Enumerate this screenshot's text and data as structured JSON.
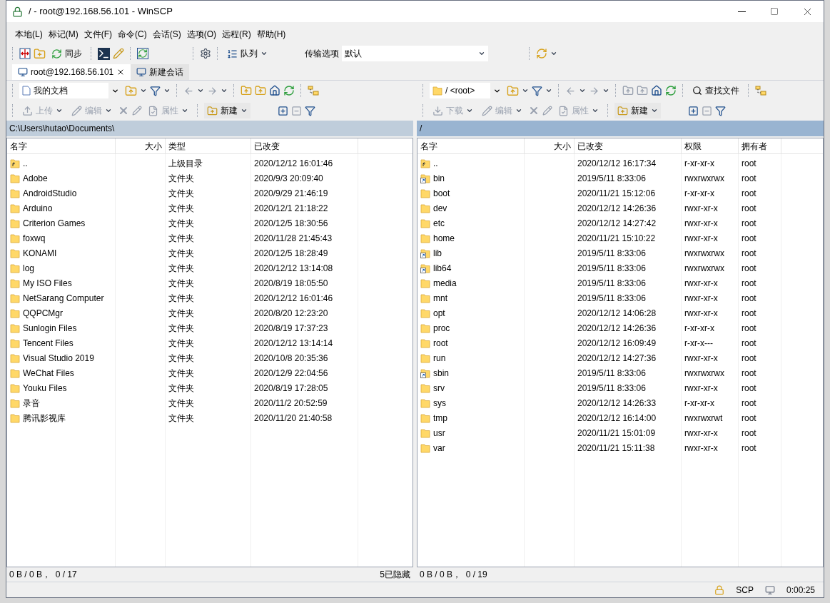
{
  "window": {
    "title": "/ - root@192.168.56.101 - WinSCP"
  },
  "menu": [
    "本地(L)",
    "标记(M)",
    "文件(F)",
    "命令(C)",
    "会话(S)",
    "选项(O)",
    "远程(R)",
    "帮助(H)"
  ],
  "toolbar": {
    "sync_label": "同步",
    "queue_label": "队列",
    "transfer_label": "传输选项",
    "transfer_value": "默认"
  },
  "tabs": [
    {
      "label": "root@192.168.56.101",
      "selected": true,
      "kind": "session"
    },
    {
      "label": "新建会话",
      "selected": false,
      "kind": "new"
    }
  ],
  "local": {
    "active": false,
    "location": "我的文档",
    "actions": [
      {
        "label": "上传",
        "disabled": true,
        "kind": "upload"
      },
      {
        "label": "编辑",
        "disabled": true,
        "kind": "edit"
      },
      {
        "label": "属性",
        "disabled": true,
        "kind": "properties"
      },
      {
        "label": "新建",
        "disabled": false,
        "kind": "new"
      }
    ],
    "path": "C:\\Users\\hutao\\Documents\\",
    "columns": [
      "名字",
      "大小",
      "类型",
      "已改变"
    ],
    "rows": [
      {
        "name": "..",
        "size": "",
        "type": "上级目录",
        "changed": "2020/12/12  16:01:46",
        "kind": "parent"
      },
      {
        "name": "Adobe",
        "type": "文件夹",
        "changed": "2020/9/3  20:09:40",
        "kind": "folder"
      },
      {
        "name": "AndroidStudio",
        "type": "文件夹",
        "changed": "2020/9/29  21:46:19",
        "kind": "folder"
      },
      {
        "name": "Arduino",
        "type": "文件夹",
        "changed": "2020/12/1  21:18:22",
        "kind": "folder"
      },
      {
        "name": "Criterion Games",
        "type": "文件夹",
        "changed": "2020/12/5  18:30:56",
        "kind": "folder"
      },
      {
        "name": "foxwq",
        "type": "文件夹",
        "changed": "2020/11/28  21:45:43",
        "kind": "folder"
      },
      {
        "name": "KONAMI",
        "type": "文件夹",
        "changed": "2020/12/5  18:28:49",
        "kind": "folder"
      },
      {
        "name": "log",
        "type": "文件夹",
        "changed": "2020/12/12  13:14:08",
        "kind": "folder"
      },
      {
        "name": "My ISO Files",
        "type": "文件夹",
        "changed": "2020/8/19  18:05:50",
        "kind": "folder"
      },
      {
        "name": "NetSarang Computer",
        "type": "文件夹",
        "changed": "2020/12/12  16:01:46",
        "kind": "folder"
      },
      {
        "name": "QQPCMgr",
        "type": "文件夹",
        "changed": "2020/8/20  12:23:20",
        "kind": "folder"
      },
      {
        "name": "Sunlogin Files",
        "type": "文件夹",
        "changed": "2020/8/19  17:37:23",
        "kind": "folder"
      },
      {
        "name": "Tencent Files",
        "type": "文件夹",
        "changed": "2020/12/12  13:14:14",
        "kind": "folder"
      },
      {
        "name": "Visual Studio 2019",
        "type": "文件夹",
        "changed": "2020/10/8  20:35:36",
        "kind": "folder"
      },
      {
        "name": "WeChat Files",
        "type": "文件夹",
        "changed": "2020/12/9  22:04:56",
        "kind": "folder"
      },
      {
        "name": "Youku Files",
        "type": "文件夹",
        "changed": "2020/8/19  17:28:05",
        "kind": "folder"
      },
      {
        "name": "录音",
        "type": "文件夹",
        "changed": "2020/11/2  20:52:59",
        "kind": "folder"
      },
      {
        "name": "腾讯影视库",
        "type": "文件夹",
        "changed": "2020/11/20  21:40:58",
        "kind": "folder"
      }
    ],
    "status": "0 B / 0 B，  0 / 17",
    "hidden": "5已隐藏"
  },
  "remote": {
    "active": true,
    "location": "/ <root>",
    "find_label": "查找文件",
    "actions": [
      {
        "label": "下载",
        "disabled": true,
        "kind": "download"
      },
      {
        "label": "编辑",
        "disabled": true,
        "kind": "edit"
      },
      {
        "label": "属性",
        "disabled": true,
        "kind": "properties"
      },
      {
        "label": "新建",
        "disabled": false,
        "kind": "new"
      }
    ],
    "path": "/",
    "columns": [
      "名字",
      "大小",
      "已改变",
      "权限",
      "拥有者"
    ],
    "rows": [
      {
        "name": "..",
        "changed": "2020/12/12 16:17:34",
        "rights": "r-xr-xr-x",
        "owner": "root",
        "kind": "parent"
      },
      {
        "name": "bin",
        "changed": "2019/5/11 8:33:06",
        "rights": "rwxrwxrwx",
        "owner": "root",
        "kind": "link"
      },
      {
        "name": "boot",
        "changed": "2020/11/21 15:12:06",
        "rights": "r-xr-xr-x",
        "owner": "root",
        "kind": "folder"
      },
      {
        "name": "dev",
        "changed": "2020/12/12 14:26:36",
        "rights": "rwxr-xr-x",
        "owner": "root",
        "kind": "folder"
      },
      {
        "name": "etc",
        "changed": "2020/12/12 14:27:42",
        "rights": "rwxr-xr-x",
        "owner": "root",
        "kind": "folder"
      },
      {
        "name": "home",
        "changed": "2020/11/21 15:10:22",
        "rights": "rwxr-xr-x",
        "owner": "root",
        "kind": "folder"
      },
      {
        "name": "lib",
        "changed": "2019/5/11 8:33:06",
        "rights": "rwxrwxrwx",
        "owner": "root",
        "kind": "link"
      },
      {
        "name": "lib64",
        "changed": "2019/5/11 8:33:06",
        "rights": "rwxrwxrwx",
        "owner": "root",
        "kind": "link"
      },
      {
        "name": "media",
        "changed": "2019/5/11 8:33:06",
        "rights": "rwxr-xr-x",
        "owner": "root",
        "kind": "folder"
      },
      {
        "name": "mnt",
        "changed": "2019/5/11 8:33:06",
        "rights": "rwxr-xr-x",
        "owner": "root",
        "kind": "folder"
      },
      {
        "name": "opt",
        "changed": "2020/12/12 14:06:28",
        "rights": "rwxr-xr-x",
        "owner": "root",
        "kind": "folder"
      },
      {
        "name": "proc",
        "changed": "2020/12/12 14:26:36",
        "rights": "r-xr-xr-x",
        "owner": "root",
        "kind": "folder"
      },
      {
        "name": "root",
        "changed": "2020/12/12 16:09:49",
        "rights": "r-xr-x---",
        "owner": "root",
        "kind": "folder"
      },
      {
        "name": "run",
        "changed": "2020/12/12 14:27:36",
        "rights": "rwxr-xr-x",
        "owner": "root",
        "kind": "folder"
      },
      {
        "name": "sbin",
        "changed": "2019/5/11 8:33:06",
        "rights": "rwxrwxrwx",
        "owner": "root",
        "kind": "link"
      },
      {
        "name": "srv",
        "changed": "2019/5/11 8:33:06",
        "rights": "rwxr-xr-x",
        "owner": "root",
        "kind": "folder"
      },
      {
        "name": "sys",
        "changed": "2020/12/12 14:26:33",
        "rights": "r-xr-xr-x",
        "owner": "root",
        "kind": "folder"
      },
      {
        "name": "tmp",
        "changed": "2020/12/12 16:14:00",
        "rights": "rwxrwxrwt",
        "owner": "root",
        "kind": "folder"
      },
      {
        "name": "usr",
        "changed": "2020/11/21 15:01:09",
        "rights": "rwxr-xr-x",
        "owner": "root",
        "kind": "folder"
      },
      {
        "name": "var",
        "changed": "2020/11/21 15:11:38",
        "rights": "rwxr-xr-x",
        "owner": "root",
        "kind": "folder"
      }
    ],
    "status": "0 B / 0 B，  0 / 19"
  },
  "status_bar": {
    "protocol": "SCP",
    "elapsed": "0:00:25"
  }
}
